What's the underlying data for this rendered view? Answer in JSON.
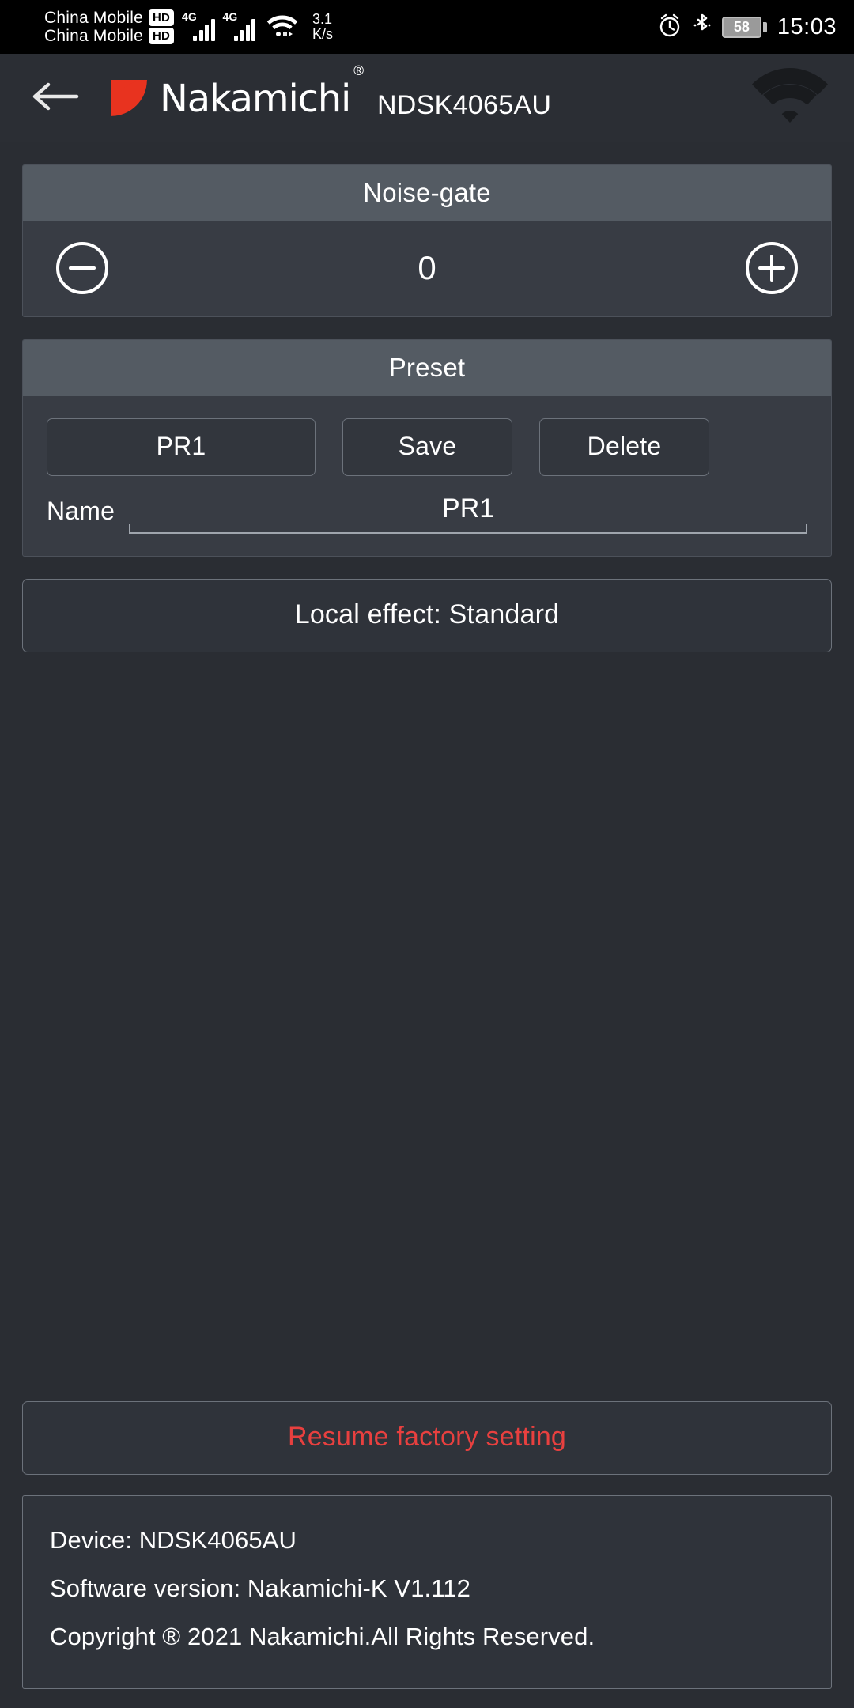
{
  "status_bar": {
    "carriers": [
      {
        "name": "China Mobile",
        "badge": "HD"
      },
      {
        "name": "China Mobile",
        "badge": "HD"
      }
    ],
    "network_type_1": "4G",
    "network_type_2": "4G",
    "speed_value": "3.1",
    "speed_unit": "K/s",
    "battery_percent": "58",
    "time": "15:03",
    "icons": [
      "alarm-icon",
      "bluetooth-icon",
      "battery-icon",
      "wifi-icon",
      "signal-icon"
    ]
  },
  "header": {
    "back_icon": "back-arrow-icon",
    "brand": "Nakamichi",
    "brand_registered": "®",
    "device_name": "NDSK4065AU",
    "wifi_icon": "wifi-icon"
  },
  "noise_gate": {
    "title": "Noise-gate",
    "value": "0",
    "decrement_icon": "minus-circle-icon",
    "increment_icon": "plus-circle-icon"
  },
  "preset": {
    "title": "Preset",
    "selected_preset": "PR1",
    "save_label": "Save",
    "delete_label": "Delete",
    "name_label": "Name",
    "name_value": "PR1",
    "name_placeholder": "PR1"
  },
  "local_effect": {
    "label": "Local effect: Standard"
  },
  "factory_reset": {
    "label": "Resume factory setting",
    "color": "#e8403f"
  },
  "device_info": {
    "lines": [
      "Device: NDSK4065AU",
      "Software version: Nakamichi-K V1.112",
      "Copyright ® 2021 Nakamichi.All Rights Reserved."
    ]
  },
  "theme": {
    "background": "#2a2d33",
    "panel_background": "#383c44",
    "panel_header": "#545b63",
    "accent_red": "#e8403f",
    "brand_red": "#e8331f",
    "border": "#6c727b"
  }
}
